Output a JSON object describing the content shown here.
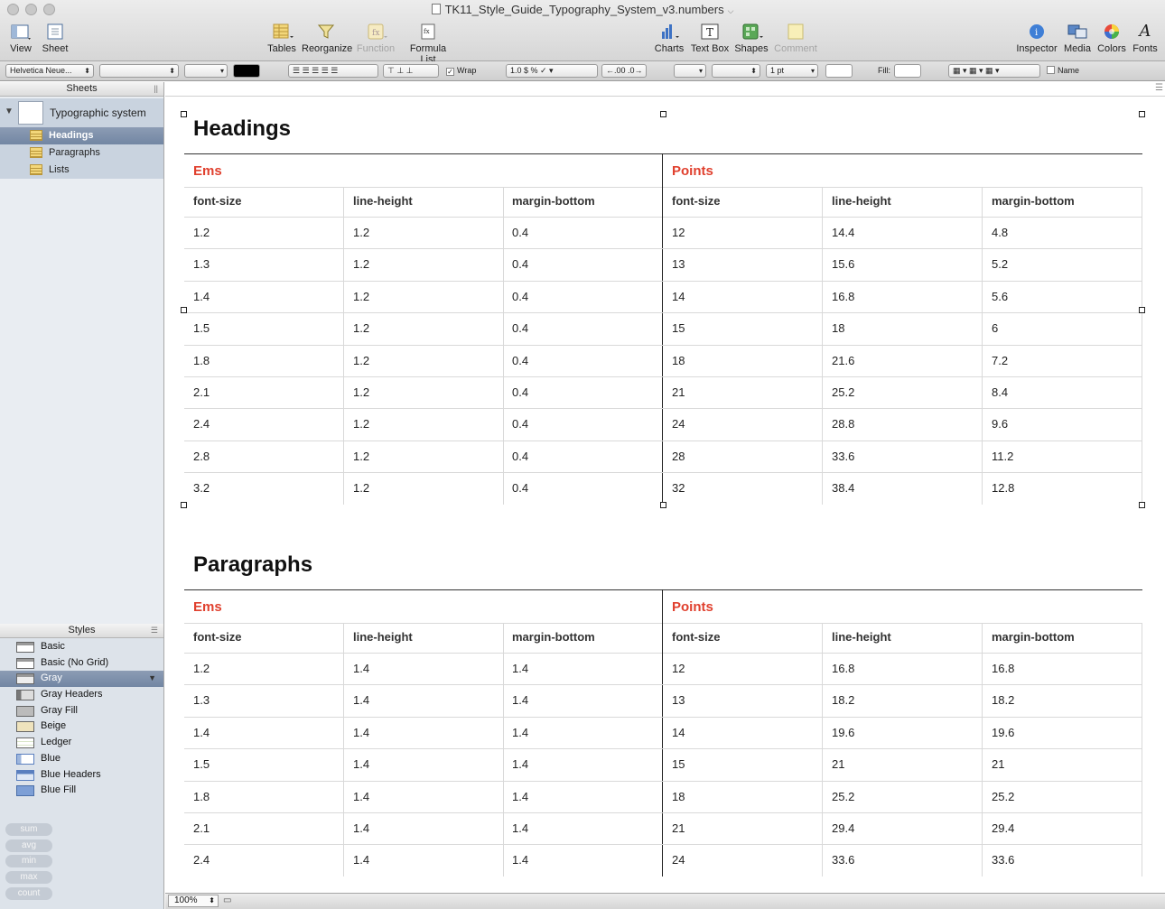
{
  "window": {
    "title": "TK11_Style_Guide_Typography_System_v3.numbers"
  },
  "toolbar": {
    "view": "View",
    "sheet": "Sheet",
    "tables": "Tables",
    "reorganize": "Reorganize",
    "function": "Function",
    "formula_list": "Formula List",
    "charts": "Charts",
    "text_box": "Text Box",
    "shapes": "Shapes",
    "comment": "Comment",
    "inspector": "Inspector",
    "media": "Media",
    "colors": "Colors",
    "fonts": "Fonts"
  },
  "formatbar": {
    "font": "Helvetica Neue...",
    "wrap": "Wrap",
    "stroke": "1 pt",
    "fill": "Fill:",
    "name": "Name",
    "decimals_more": "←.00",
    "decimals_less": ".0→"
  },
  "sidebar": {
    "sheets_header": "Sheets",
    "sheet_name": "Typographic system",
    "tables": [
      {
        "label": "Headings",
        "selected": true
      },
      {
        "label": "Paragraphs",
        "selected": false
      },
      {
        "label": "Lists",
        "selected": false
      }
    ],
    "styles_header": "Styles",
    "styles": [
      "Basic",
      "Basic (No Grid)",
      "Gray",
      "Gray Headers",
      "Gray Fill",
      "Beige",
      "Ledger",
      "Blue",
      "Blue Headers",
      "Blue Fill"
    ],
    "selected_style": "Gray",
    "functions": [
      "sum",
      "avg",
      "min",
      "max",
      "count"
    ]
  },
  "tables": [
    {
      "title": "Headings",
      "groups": [
        "Ems",
        "Points"
      ],
      "columns": [
        "font-size",
        "line-height",
        "margin-bottom",
        "font-size",
        "line-height",
        "margin-bottom"
      ],
      "rows": [
        [
          "1.2",
          "1.2",
          "0.4",
          "12",
          "14.4",
          "4.8"
        ],
        [
          "1.3",
          "1.2",
          "0.4",
          "13",
          "15.6",
          "5.2"
        ],
        [
          "1.4",
          "1.2",
          "0.4",
          "14",
          "16.8",
          "5.6"
        ],
        [
          "1.5",
          "1.2",
          "0.4",
          "15",
          "18",
          "6"
        ],
        [
          "1.8",
          "1.2",
          "0.4",
          "18",
          "21.6",
          "7.2"
        ],
        [
          "2.1",
          "1.2",
          "0.4",
          "21",
          "25.2",
          "8.4"
        ],
        [
          "2.4",
          "1.2",
          "0.4",
          "24",
          "28.8",
          "9.6"
        ],
        [
          "2.8",
          "1.2",
          "0.4",
          "28",
          "33.6",
          "11.2"
        ],
        [
          "3.2",
          "1.2",
          "0.4",
          "32",
          "38.4",
          "12.8"
        ]
      ]
    },
    {
      "title": "Paragraphs",
      "groups": [
        "Ems",
        "Points"
      ],
      "columns": [
        "font-size",
        "line-height",
        "margin-bottom",
        "font-size",
        "line-height",
        "margin-bottom"
      ],
      "rows": [
        [
          "1.2",
          "1.4",
          "1.4",
          "12",
          "16.8",
          "16.8"
        ],
        [
          "1.3",
          "1.4",
          "1.4",
          "13",
          "18.2",
          "18.2"
        ],
        [
          "1.4",
          "1.4",
          "1.4",
          "14",
          "19.6",
          "19.6"
        ],
        [
          "1.5",
          "1.4",
          "1.4",
          "15",
          "21",
          "21"
        ],
        [
          "1.8",
          "1.4",
          "1.4",
          "18",
          "25.2",
          "25.2"
        ],
        [
          "2.1",
          "1.4",
          "1.4",
          "21",
          "29.4",
          "29.4"
        ],
        [
          "2.4",
          "1.4",
          "1.4",
          "24",
          "33.6",
          "33.6"
        ]
      ]
    }
  ],
  "status": {
    "zoom": "100%"
  }
}
